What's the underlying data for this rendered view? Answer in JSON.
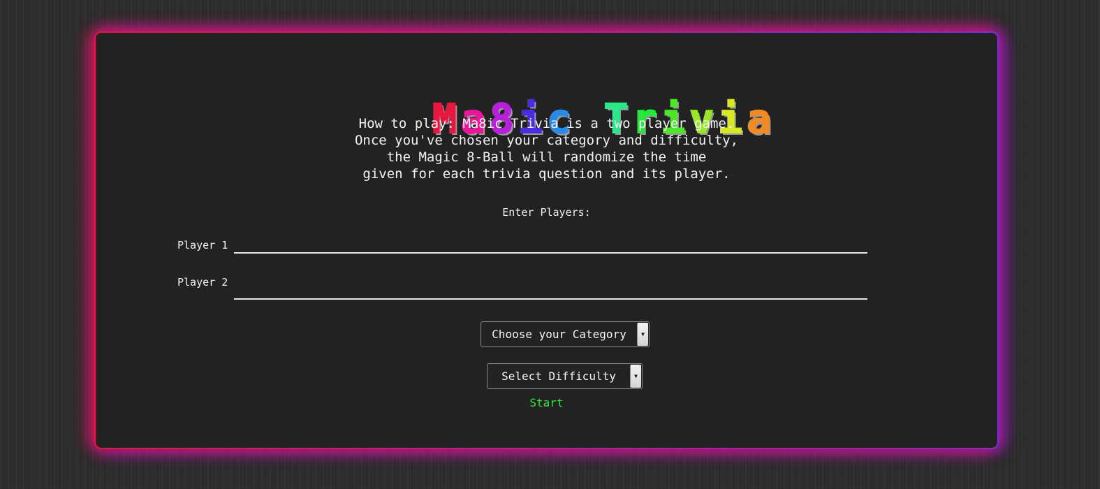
{
  "title": {
    "text": "Ma8ic Trivia",
    "letters": [
      {
        "ch": "M",
        "color": "#e8173f"
      },
      {
        "ch": "a",
        "color": "#e8179a"
      },
      {
        "ch": "8",
        "color": "#b521d8"
      },
      {
        "ch": "i",
        "color": "#4a2ce0"
      },
      {
        "ch": "c",
        "color": "#2a8ae8"
      },
      {
        "ch": " ",
        "color": "#3a3a3a"
      },
      {
        "ch": "T",
        "color": "#2ae88a"
      },
      {
        "ch": "r",
        "color": "#25e83a"
      },
      {
        "ch": "i",
        "color": "#4ae825"
      },
      {
        "ch": "v",
        "color": "#9ae825"
      },
      {
        "ch": "i",
        "color": "#d8e825"
      },
      {
        "ch": "a",
        "color": "#f08a25"
      }
    ]
  },
  "instructions": [
    "How to play: Ma8ic Trivia is a two player game.",
    "Once you've chosen your category and difficulty,",
    "the Magic 8-Ball will randomize the time",
    "given for each trivia question and its player."
  ],
  "players": {
    "heading": "Enter Players:",
    "player1_label": "Player 1",
    "player1_value": "",
    "player2_label": "Player 2",
    "player2_value": ""
  },
  "category_select": {
    "selected": "Choose your Category",
    "icon": "chevron-down-icon"
  },
  "difficulty_select": {
    "selected": "Select Difficulty",
    "icon": "chevron-down-icon"
  },
  "start_label": "Start",
  "colors": {
    "start": "#37e637",
    "glow_left": "#e8173f",
    "glow_right": "#7e2ae0",
    "panel": "#222222"
  }
}
